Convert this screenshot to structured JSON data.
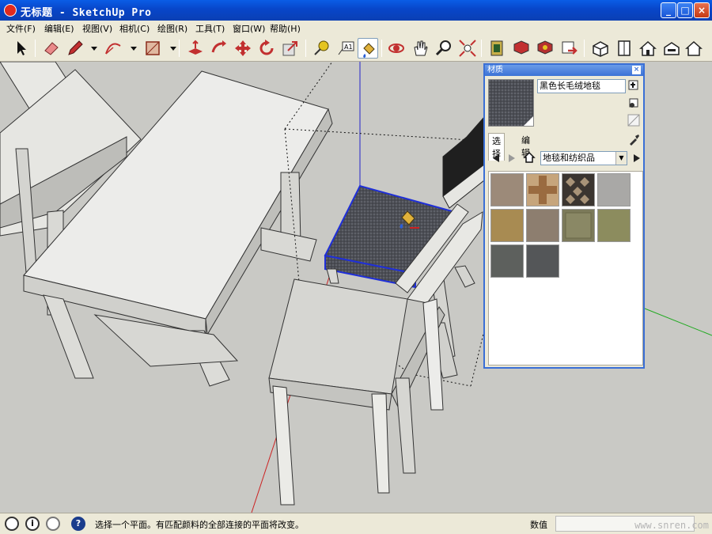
{
  "window": {
    "title": "无标题 - SketchUp Pro",
    "buttons": {
      "minimize": "_",
      "maximize": "□",
      "close": "×"
    }
  },
  "menu": [
    {
      "label": "文件(F)"
    },
    {
      "label": "编辑(E)"
    },
    {
      "label": "视图(V)"
    },
    {
      "label": "相机(C)"
    },
    {
      "label": "绘图(R)"
    },
    {
      "label": "工具(T)"
    },
    {
      "label": "窗口(W)"
    },
    {
      "label": "帮助(H)"
    }
  ],
  "toolbar": {
    "tools": [
      "select-icon",
      "eraser-icon",
      "pencil-icon",
      "arc-icon",
      "rectangle-icon",
      "push-pull-icon",
      "follow-me-icon",
      "move-icon",
      "rotate-icon",
      "scale-icon",
      "tape-measure-icon",
      "text-icon",
      "paint-bucket-icon",
      "orbit-icon",
      "pan-icon",
      "zoom-icon",
      "zoom-extents-icon",
      "get-models-icon",
      "share-model-icon",
      "components-icon",
      "send-to-layout-icon",
      "iso-view-icon",
      "top-view-icon",
      "front-view-icon",
      "right-view-icon",
      "back-view-icon"
    ],
    "active_tool": "paint-bucket-icon"
  },
  "materials_panel": {
    "title": "材质",
    "close": "×",
    "material_name": "黑色长毛绒地毯",
    "tabs": [
      {
        "label": "选择"
      },
      {
        "label": "编辑"
      }
    ],
    "active_tab": "选择",
    "library": "地毯和纺织品",
    "swatches": [
      {
        "name": "carpet-tan",
        "color": "#9c8a79"
      },
      {
        "name": "tile-cross",
        "color": "#b9936b"
      },
      {
        "name": "patterned-dark",
        "color": "#3b3530"
      },
      {
        "name": "carpet-grey",
        "color": "#a9a8a6"
      },
      {
        "name": "carpet-beige",
        "color": "#a88b52"
      },
      {
        "name": "carpet-speckle",
        "color": "#8d7e6f"
      },
      {
        "name": "carpet-olive-square",
        "color": "#7c7a5a"
      },
      {
        "name": "carpet-olive",
        "color": "#8c8c5e"
      },
      {
        "name": "carpet-dark-grey",
        "color": "#5d605d"
      },
      {
        "name": "carpet-black",
        "color": "#545658"
      }
    ]
  },
  "statusbar": {
    "message": "选择一个平面。有匹配颜料的全部连接的平面将改变。",
    "value_label": "数值",
    "value": "",
    "help": "?"
  },
  "watermark": "www.snren.com",
  "colors": {
    "title_blue": "#0846c9",
    "selection_blue": "#1f2fd8",
    "axis_red": "#cc2222",
    "axis_green": "#22aa22",
    "axis_blue": "#2222cc"
  }
}
